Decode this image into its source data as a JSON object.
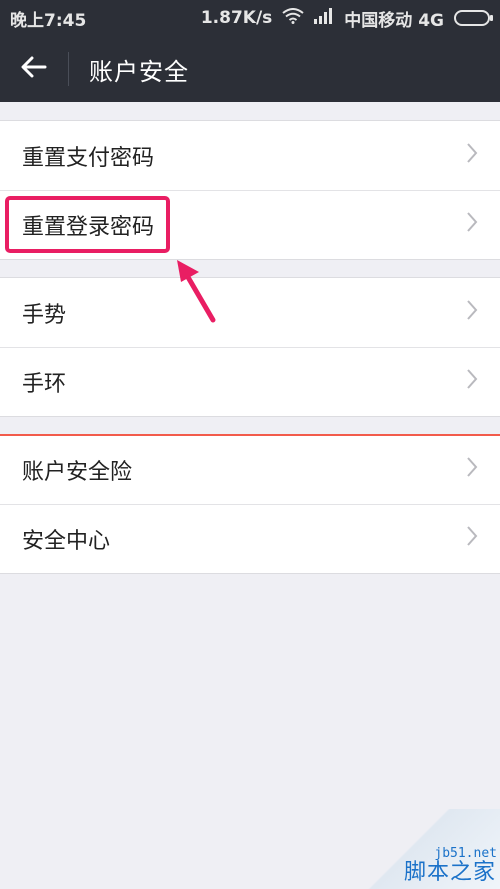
{
  "status_bar": {
    "time": "晚上7:45",
    "speed": "1.87K/s",
    "carrier": "中国移动 4G"
  },
  "header": {
    "title": "账户安全"
  },
  "groups": [
    {
      "items": [
        {
          "label": "重置支付密码"
        },
        {
          "label": "重置登录密码"
        }
      ]
    },
    {
      "items": [
        {
          "label": "手势"
        },
        {
          "label": "手环"
        }
      ]
    },
    {
      "items": [
        {
          "label": "账户安全险"
        },
        {
          "label": "安全中心"
        }
      ]
    }
  ],
  "colors": {
    "header_bg": "#2c2f37",
    "page_bg": "#efeff4",
    "highlight": "#e91e63",
    "accent_line": "#f25b4b"
  },
  "watermark": {
    "url": "jb51.net",
    "name": "脚本之家"
  }
}
